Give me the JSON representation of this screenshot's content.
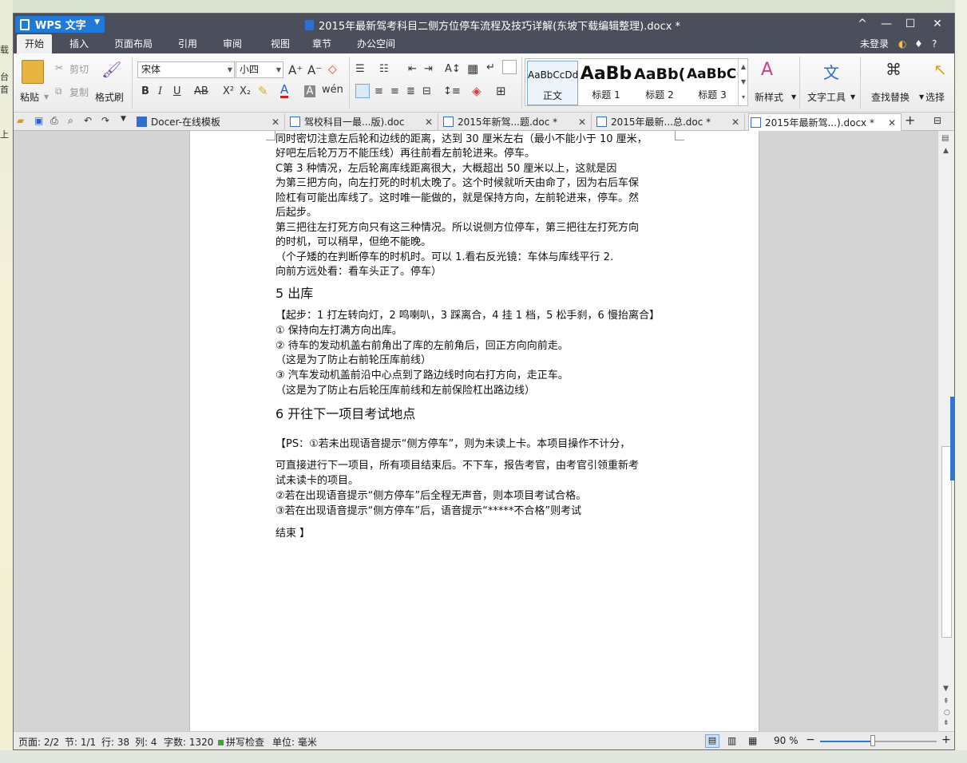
{
  "background": {
    "left_labels": [
      "载",
      "台首",
      "上"
    ]
  },
  "app": {
    "name": "WPS 文字",
    "doc_title": "2015年最新驾考科目二侧方位停车流程及技巧详解(东坡下载编辑整理).docx *",
    "controls": [
      "^",
      "—",
      "☐",
      "✕"
    ]
  },
  "menu": {
    "items": [
      "开始",
      "插入",
      "页面布局",
      "引用",
      "审阅",
      "视图",
      "章节",
      "办公空间"
    ],
    "login": "未登录",
    "help": "?"
  },
  "ribbon": {
    "paste": "粘贴",
    "cut": "剪切",
    "copy": "复制",
    "format_painter": "格式刷",
    "font_name": "宋体",
    "font_size": "小四",
    "styles": [
      {
        "preview": "AaBbCcDd",
        "label": "正文"
      },
      {
        "preview": "AaBb",
        "label": "标题 1"
      },
      {
        "preview": "AaBb(",
        "label": "标题 2"
      },
      {
        "preview": "AaBbC(",
        "label": "标题 3"
      }
    ],
    "new_style": "新样式",
    "text_tools": "文字工具",
    "find_replace": "查找替换",
    "select": "选择"
  },
  "tabs": [
    {
      "label": "Docer-在线模板",
      "type": "docer"
    },
    {
      "label": "驾校科目一最...版).doc",
      "type": "doc"
    },
    {
      "label": "2015年新驾...题.doc *",
      "type": "doc"
    },
    {
      "label": "2015年最新...总.doc *",
      "type": "doc"
    },
    {
      "label": "2015年最新驾...).docx *",
      "type": "doc",
      "active": true
    }
  ],
  "document": {
    "lines": [
      "同时密切注意左后轮和边线的距离，达到 30 厘米左右（最小不能小于 10 厘米，",
      "好吧左后轮万万不能压线）再往前看左前轮进来。停车。",
      "      C第 3 种情况，左后轮离库线距离很大，大概超出 50 厘米以上，这就是因",
      "为第三把方向，向左打死的时机太晚了。这个时候就听天由命了，因为右后车保",
      "险杠有可能出库线了。这时唯一能做的，就是保持方向，左前轮进来，停车。然",
      "后起步。",
      "第三把往左打死方向只有这三种情况。所以说侧方位停车，第三把往左打死方向",
      "的时机，可以稍早，但绝不能晚。",
      "      （个子矮的在判断停车的时机时。可以 1.看右反光镜：车体与库线平行 2.",
      "向前方远处看：看车头正了。停车）",
      "5 出库",
      "【起步：1 打左转向灯，2 鸣喇叭，3 踩离合，4 挂 1 档，5 松手刹，6 慢抬离合】",
      "① 保持向左打满方向出库。",
      "② 待车的发动机盖右前角出了库的左前角后，回正方向向前走。",
      "    （这是为了防止右前轮压库前线）",
      "③ 汽车发动机盖前沿中心点到了路边线时向右打方向，走正车。",
      "    （这是为了防止右后轮压库前线和左前保险杠出路边线）",
      "6 开往下一项目考试地点",
      "【PS：①若未出现语音提示“侧方停车”，则为未读上卡。本项目操作不计分，",
      "可直接进行下一项目，所有项目结束后。不下车，报告考官，由考官引领重新考",
      "试未读卡的项目。",
      "        ②若在出现语音提示“侧方停车”后全程无声音，则本项目考试合格。",
      "        ③若在出现语音提示“侧方停车”后，语音提示“*****不合格”则考试",
      "结束 】"
    ]
  },
  "status": {
    "page": "页面: 2/2",
    "section": "节: 1/1",
    "row": "行: 38",
    "col": "列: 4",
    "words": "字数: 1320",
    "spell": "拼写检查",
    "unit": "单位: 毫米",
    "zoom": "90 %",
    "zoom_level": 0.45
  },
  "colors": {
    "titlebar": "#4b4f5c",
    "accent": "#1e7ad6",
    "scroll_accent": "#2e78d2"
  }
}
